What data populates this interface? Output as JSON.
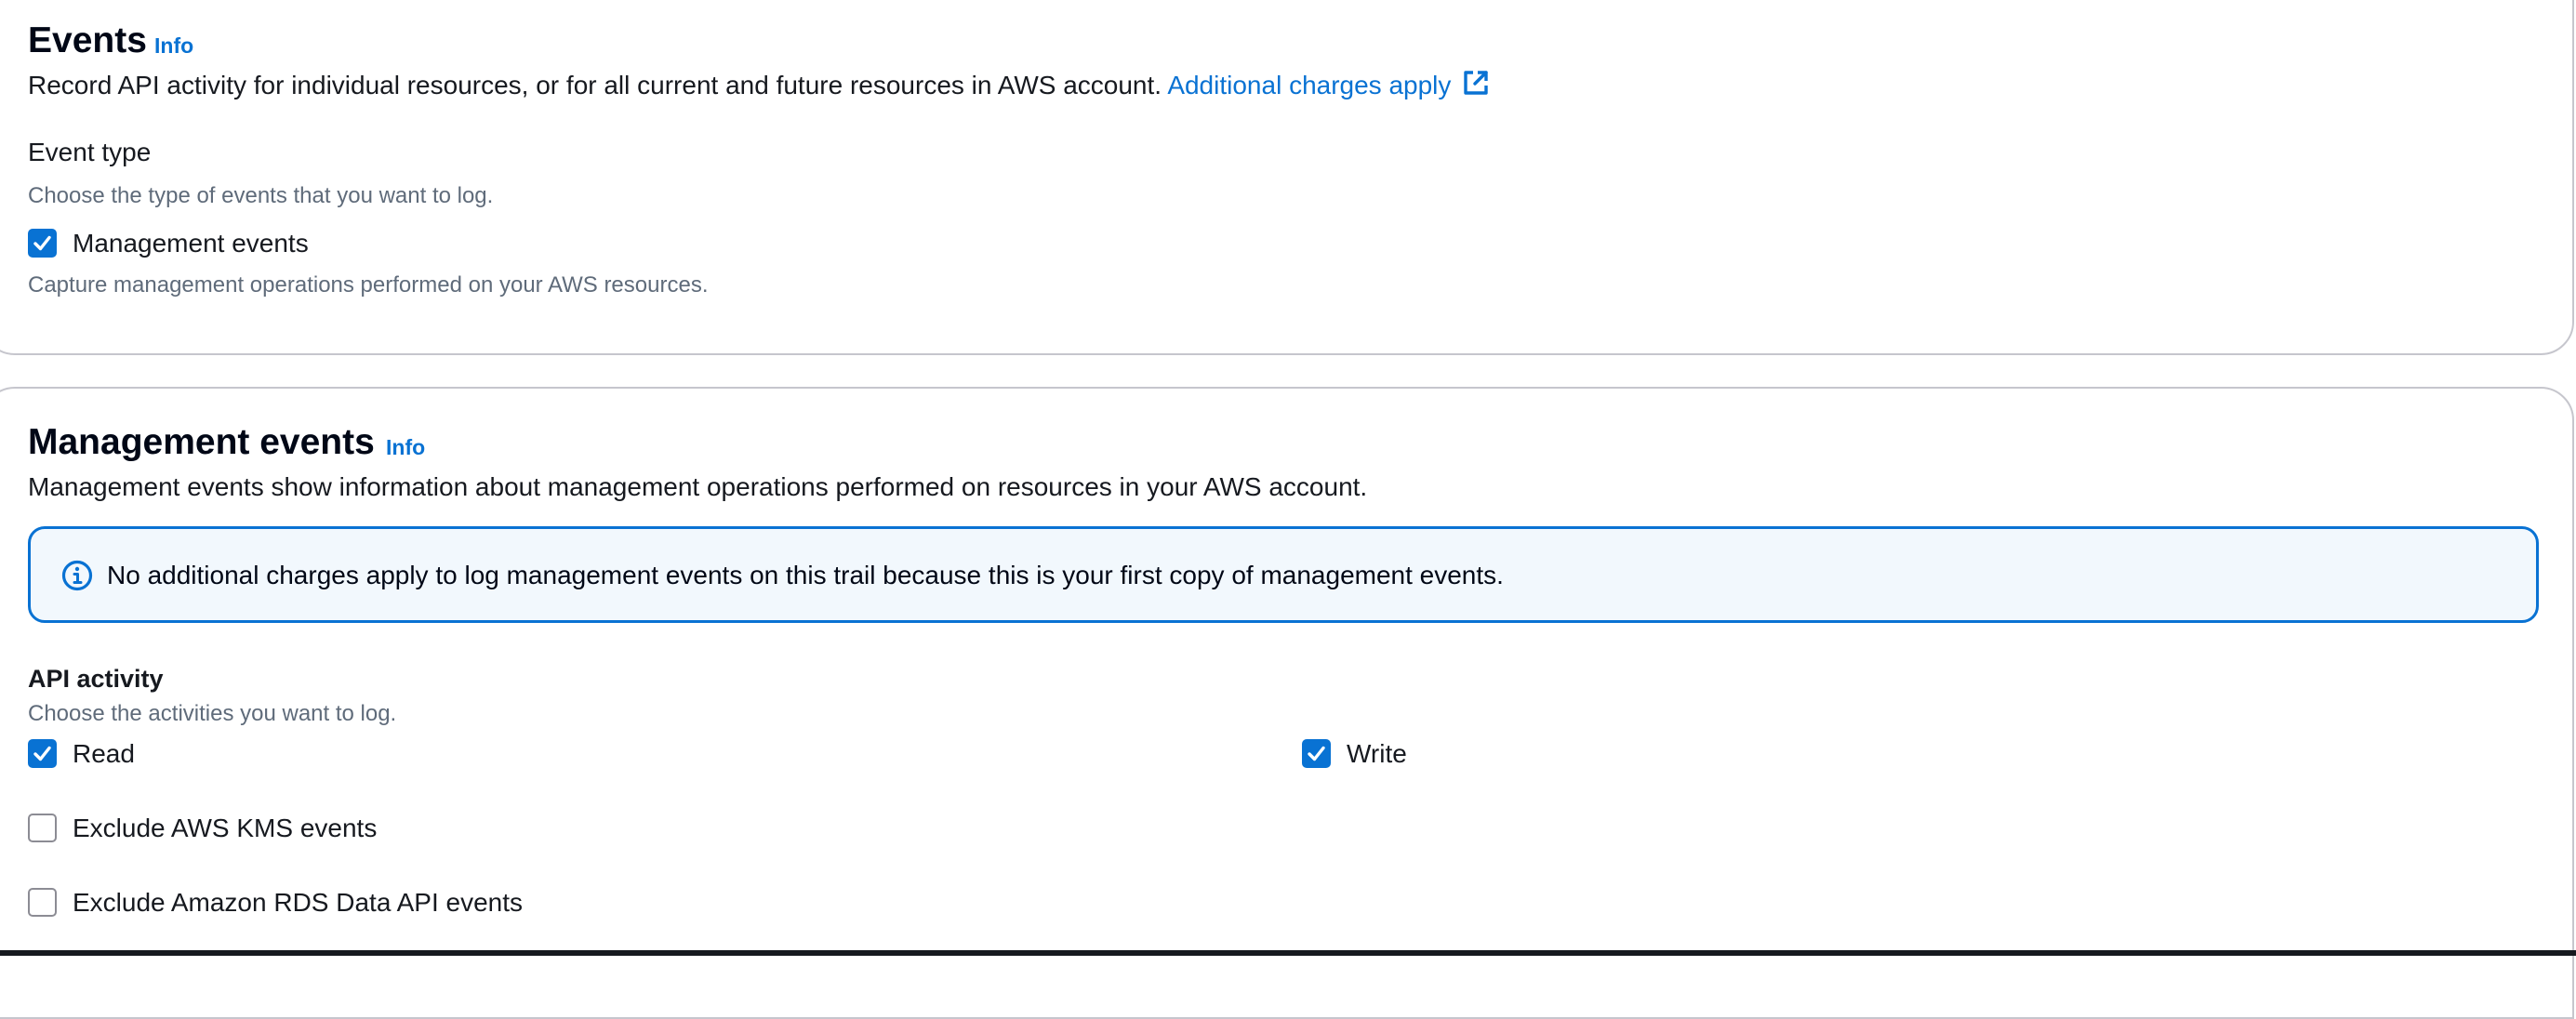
{
  "events_section": {
    "title": "Events",
    "info": "Info",
    "description": "Record API activity for individual resources, or for all current and future resources in AWS account.",
    "charges_link": "Additional charges apply",
    "charges_link_icon": "external-link-icon",
    "event_type": {
      "label": "Event type",
      "hint": "Choose the type of events that you want to log.",
      "management_events": {
        "label": "Management events",
        "checked": true,
        "description": "Capture management operations performed on your AWS resources."
      }
    }
  },
  "management_section": {
    "title": "Management events",
    "info": "Info",
    "description": "Management events show information about management operations performed on resources in your AWS account.",
    "alert": {
      "icon": "info-circle-icon",
      "text": "No additional charges apply to log management events on this trail because this is your first copy of management events."
    },
    "api_activity": {
      "label": "API activity",
      "hint": "Choose the activities you want to log.",
      "read": {
        "label": "Read",
        "checked": true
      },
      "write": {
        "label": "Write",
        "checked": true
      },
      "exclude_kms": {
        "label": "Exclude AWS KMS events",
        "checked": false
      },
      "exclude_rds": {
        "label": "Exclude Amazon RDS Data API events",
        "checked": false
      }
    }
  },
  "colors": {
    "link": "#0972d3",
    "checkbox_checked": "#0972d3",
    "alert_background": "#f2f8fd",
    "alert_border": "#0972d3",
    "text": "#16191f",
    "hint": "#5f6b7a"
  }
}
